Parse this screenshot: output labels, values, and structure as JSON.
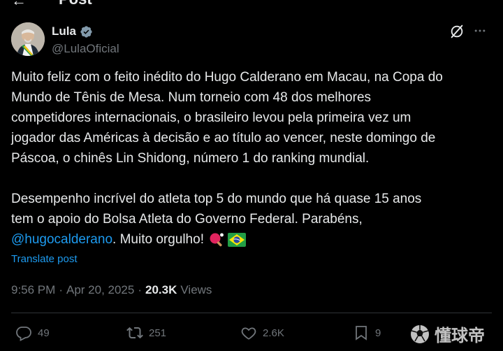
{
  "header": {
    "title": "Post"
  },
  "author": {
    "name": "Lula",
    "handle": "@LulaOficial"
  },
  "tweet": {
    "lines": [
      "Muito feliz com o feito inédito do Hugo Calderano em Macau, na Copa do",
      "Mundo de Tênis de Mesa. Num torneio com 48 dos melhores",
      "competidores internacionais, o brasileiro levou pela primeira vez um",
      "jogador das Américas à decisão e ao título ao vencer, neste domingo de",
      "Páscoa, o chinês Lin Shidong, número 1 do ranking mundial."
    ],
    "lines2": [
      "Desempenho incrível do atleta top 5 do mundo que há quase 15 anos",
      "tem o apoio do Bolsa Atleta do Governo Federal. Parabéns,"
    ],
    "mention": "@hugocalderano",
    "closing": ". Muito orgulho!",
    "emojis": [
      "table-tennis-paddle",
      "brazil-flag"
    ]
  },
  "translate_label": "Translate post",
  "meta": {
    "time": "9:56 PM",
    "separator": "·",
    "date": "Apr 20, 2025",
    "views_count": "20.3K",
    "views_label": "Views"
  },
  "actions": {
    "replies": "49",
    "reposts": "251",
    "likes": "2.6K",
    "bookmarks": "9"
  },
  "watermark": "懂球帝",
  "colors": {
    "background": "#000000",
    "text": "#e7e9ea",
    "muted": "#71767b",
    "accent": "#1d9bf0",
    "verified": "#829aab"
  }
}
